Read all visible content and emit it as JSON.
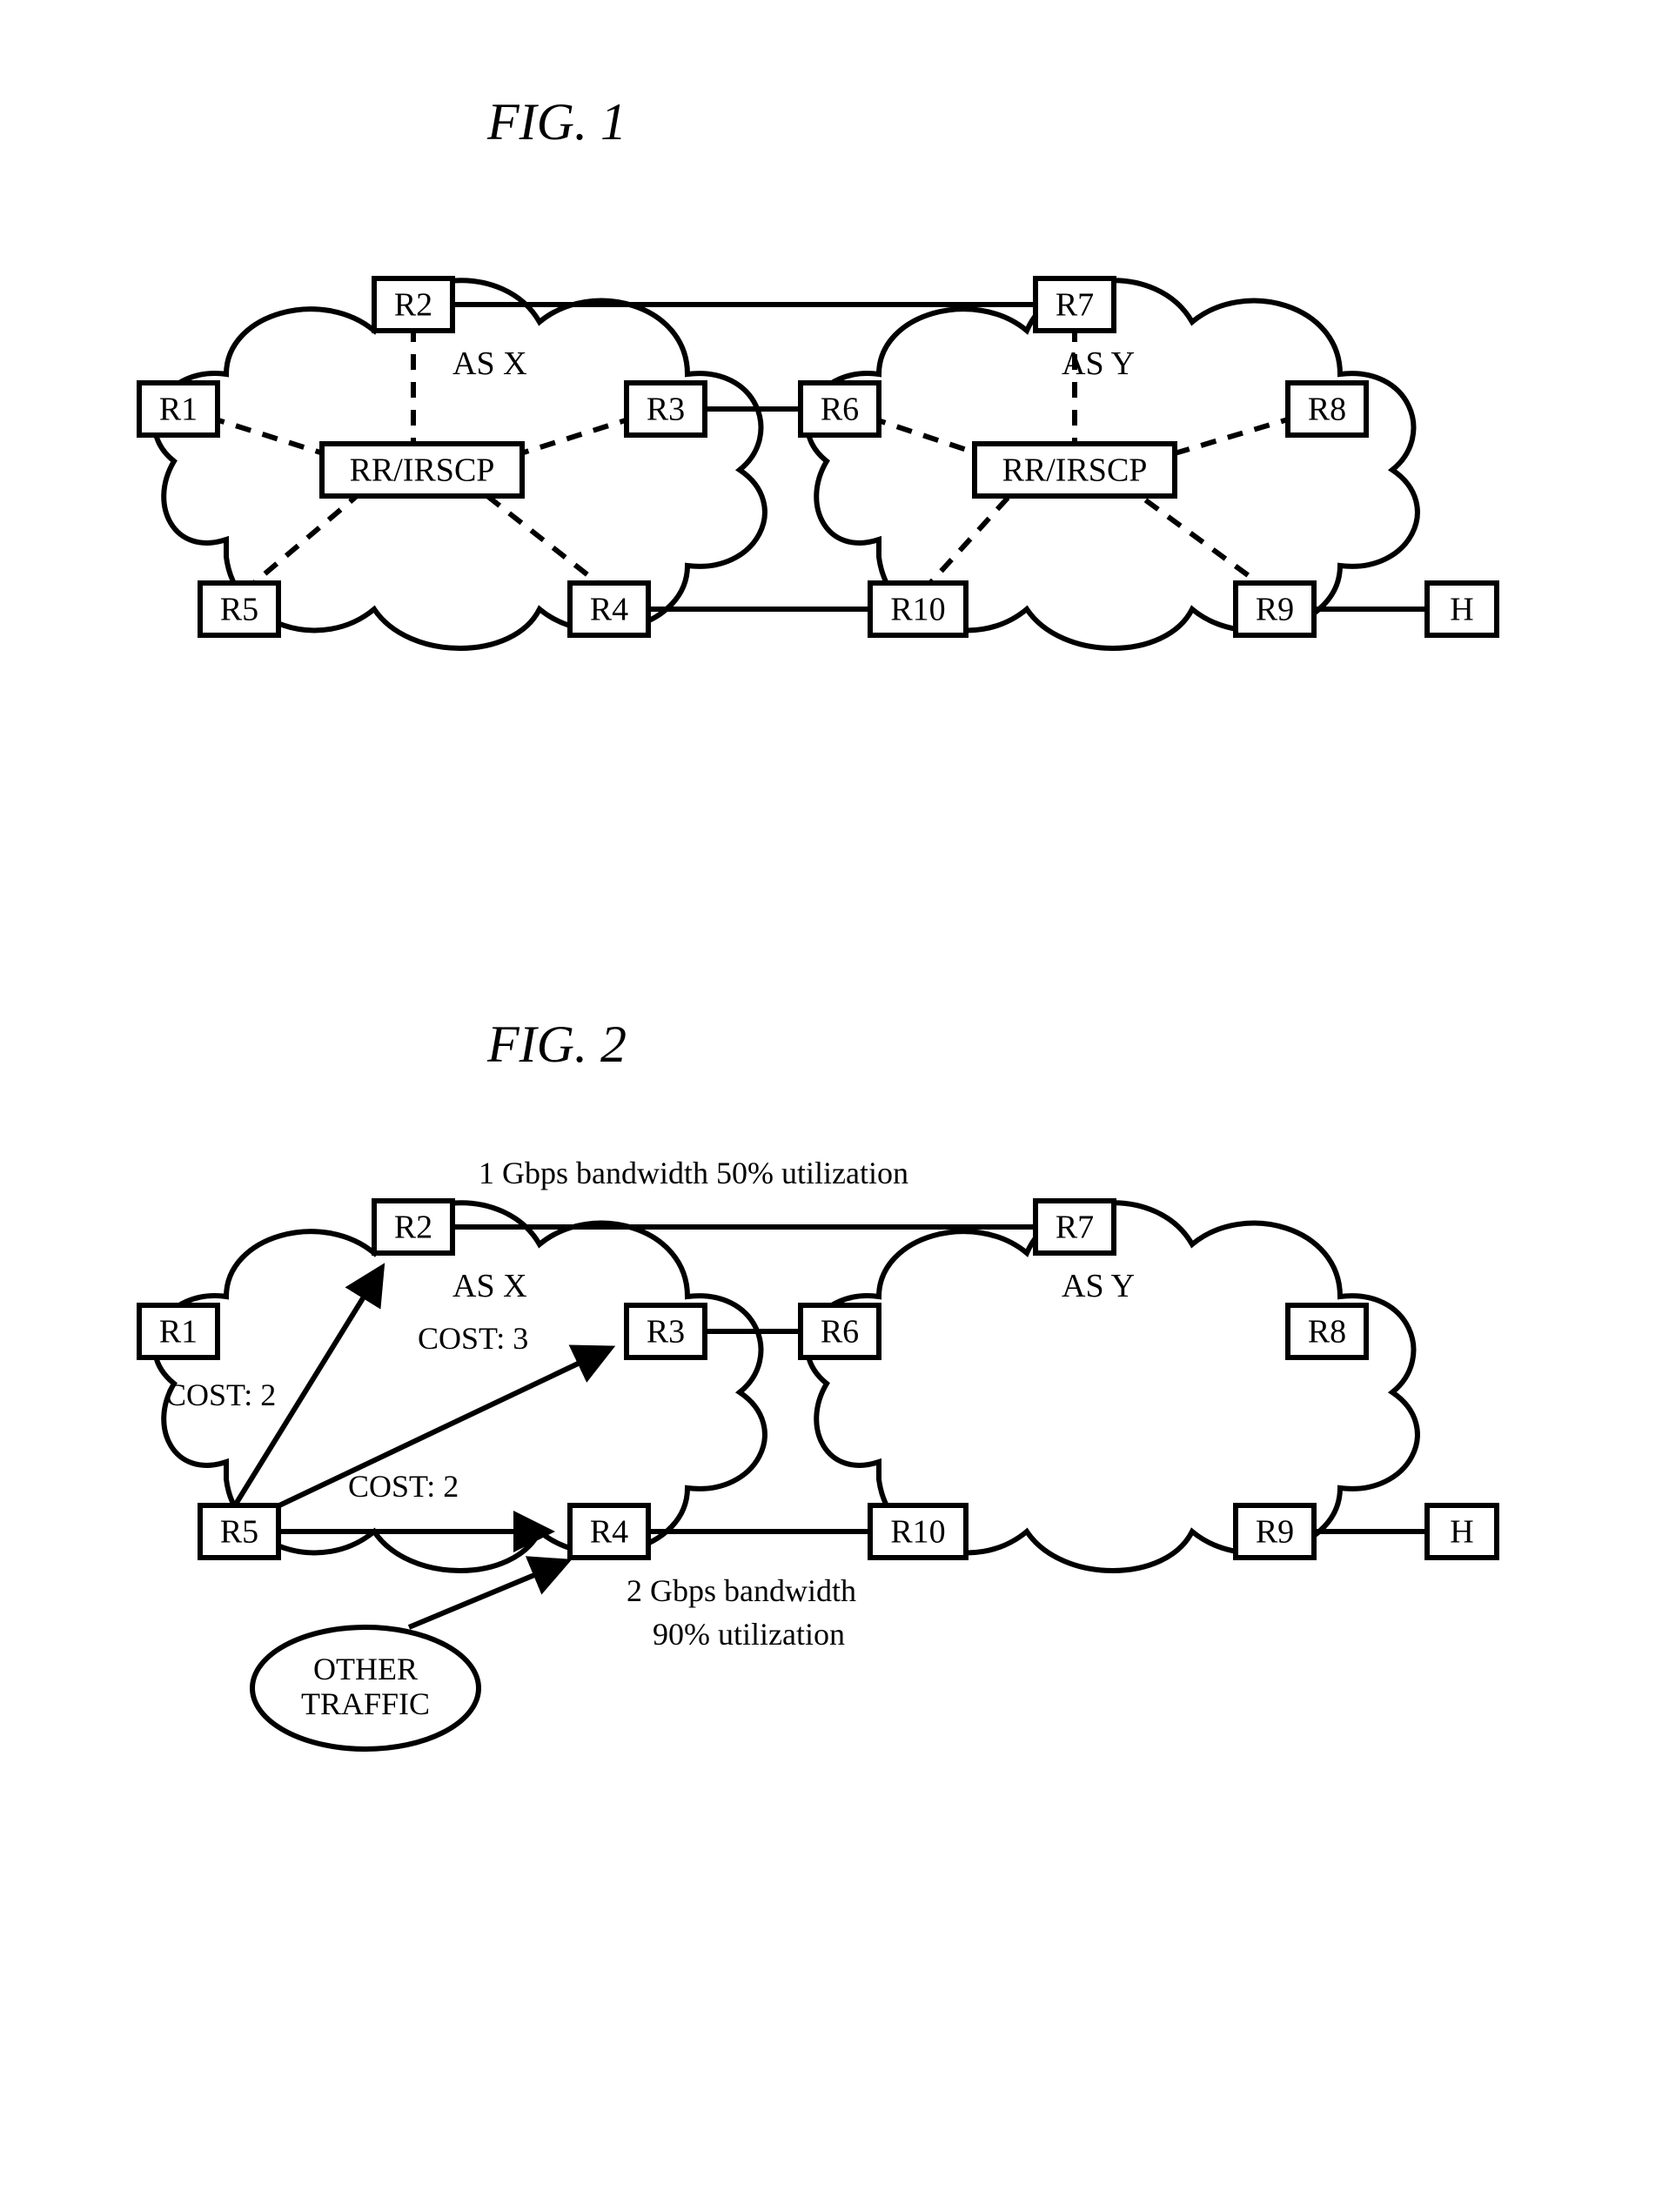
{
  "fig1": {
    "title": "FIG. 1",
    "nodes": {
      "R1": "R1",
      "R2": "R2",
      "R3": "R3",
      "R4": "R4",
      "R5": "R5",
      "R6": "R6",
      "R7": "R7",
      "R8": "R8",
      "R9": "R9",
      "R10": "R10",
      "RR_X": "RR/IRSCP",
      "RR_Y": "RR/IRSCP",
      "H": "H"
    },
    "as_labels": {
      "X": "AS X",
      "Y": "AS Y"
    }
  },
  "fig2": {
    "title": "FIG. 2",
    "nodes": {
      "R1": "R1",
      "R2": "R2",
      "R3": "R3",
      "R4": "R4",
      "R5": "R5",
      "R6": "R6",
      "R7": "R7",
      "R8": "R8",
      "R9": "R9",
      "R10": "R10",
      "H": "H"
    },
    "as_labels": {
      "X": "AS X",
      "Y": "AS Y"
    },
    "link_top": "1 Gbps bandwidth 50% utilization",
    "link_bottom_1": "2 Gbps bandwidth",
    "link_bottom_2": "90% utilization",
    "cost_r5_r2": "COST: 2",
    "cost_r5_r3": "COST: 3",
    "cost_r5_r4": "COST: 2",
    "other_traffic_1": "OTHER",
    "other_traffic_2": "TRAFFIC"
  },
  "chart_data": {
    "type": "diagram",
    "description": "Two network topology diagrams showing Autonomous Systems X and Y interconnected via border routers, with a Route Reflector / IRSCP in each AS (Fig.1) and routing cost / link utilization annotations (Fig.2).",
    "fig1": {
      "autonomous_systems": [
        {
          "name": "AS X",
          "routers": [
            "R1",
            "R2",
            "R3",
            "R4",
            "R5"
          ],
          "route_reflector": "RR/IRSCP"
        },
        {
          "name": "AS Y",
          "routers": [
            "R6",
            "R7",
            "R8",
            "R9",
            "R10"
          ],
          "route_reflector": "RR/IRSCP"
        }
      ],
      "external_host": "H",
      "solid_links": [
        [
          "R2",
          "R7"
        ],
        [
          "R3",
          "R6"
        ],
        [
          "R4",
          "R10"
        ],
        [
          "R9",
          "H"
        ]
      ],
      "dashed_links_to_RR_X": [
        "R1",
        "R2",
        "R3",
        "R4",
        "R5"
      ],
      "dashed_links_to_RR_Y": [
        "R6",
        "R7",
        "R8",
        "R9",
        "R10"
      ]
    },
    "fig2": {
      "autonomous_systems": [
        {
          "name": "AS X",
          "routers": [
            "R1",
            "R2",
            "R3",
            "R4",
            "R5"
          ]
        },
        {
          "name": "AS Y",
          "routers": [
            "R6",
            "R7",
            "R8",
            "R9",
            "R10"
          ]
        }
      ],
      "external_host": "H",
      "inter_as_links": [
        {
          "from": "R2",
          "to": "R7",
          "bandwidth_gbps": 1,
          "utilization_pct": 50
        },
        {
          "from": "R3",
          "to": "R6"
        },
        {
          "from": "R4",
          "to": "R10",
          "bandwidth_gbps": 2,
          "utilization_pct": 90
        }
      ],
      "cost_paths_from_R5": [
        {
          "to": "R2",
          "cost": 2
        },
        {
          "to": "R3",
          "cost": 3
        },
        {
          "to": "R4",
          "cost": 2
        }
      ],
      "other_traffic_into": "R4",
      "host_link": [
        "R9",
        "H"
      ]
    }
  }
}
